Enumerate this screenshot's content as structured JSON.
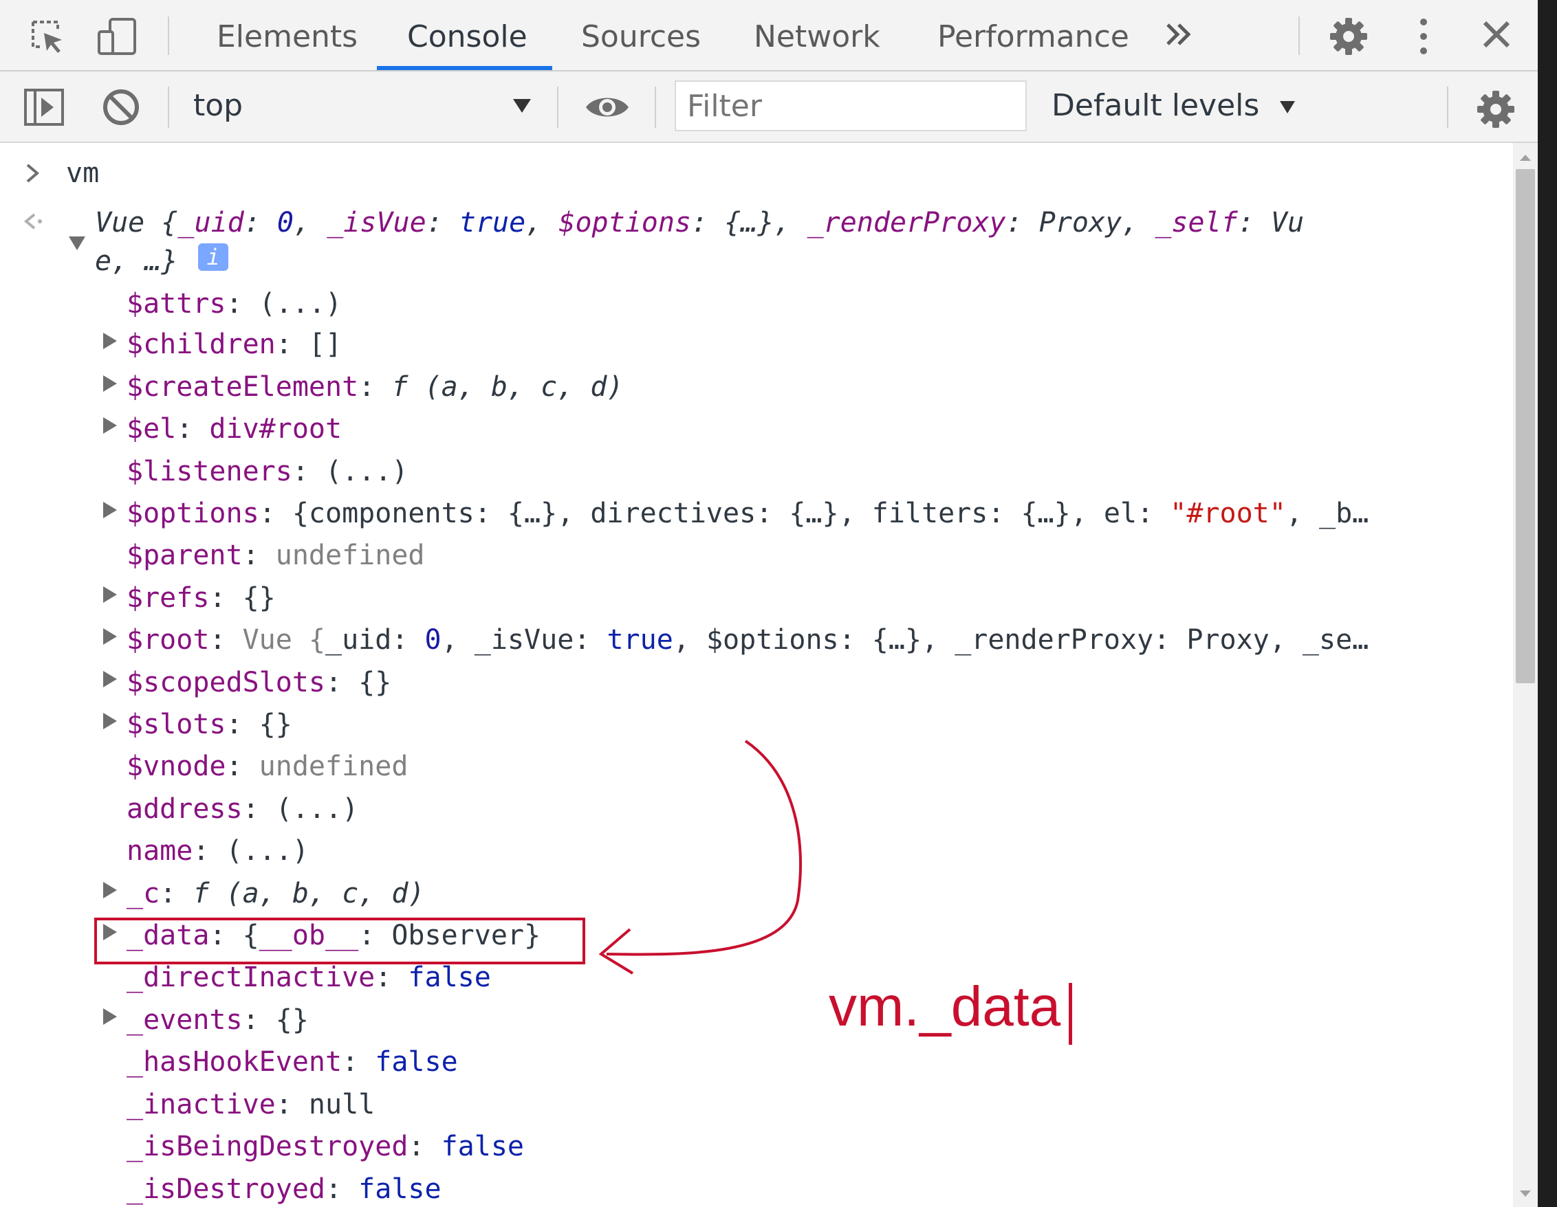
{
  "tabs": [
    {
      "label": "Elements"
    },
    {
      "label": "Console",
      "active": true
    },
    {
      "label": "Sources"
    },
    {
      "label": "Network"
    },
    {
      "label": "Performance"
    }
  ],
  "tabbar_icons": [
    "inspect-element-icon",
    "device-toolbar-icon",
    "more-tabs-icon",
    "settings-gear-icon",
    "kebab-menu-icon",
    "close-icon"
  ],
  "toolbar": {
    "context": "top",
    "filter_placeholder": "Filter",
    "levels": "Default levels"
  },
  "console": {
    "input": "vm",
    "summary": {
      "line1": [
        "Vue {",
        "_uid",
        ": ",
        "0",
        ", ",
        "_isVue",
        ": ",
        "true",
        ", ",
        "$options",
        ": {…}, ",
        "_renderProxy",
        ": Proxy, ",
        "_self",
        ": Vu"
      ],
      "line2": "e, …}"
    },
    "props": [
      {
        "key": "$attrs",
        "sep": ": ",
        "value": "(...)",
        "expandable": false
      },
      {
        "key": "$children",
        "sep": ": ",
        "value": "[]",
        "expandable": true
      },
      {
        "key": "$createElement",
        "sep": ": ",
        "value": "f (a, b, c, d)",
        "expandable": true
      },
      {
        "key": "$el",
        "sep": ": ",
        "value": "div#root",
        "expandable": true
      },
      {
        "key": "$listeners",
        "sep": ": ",
        "value": "(...)",
        "expandable": false
      },
      {
        "key": "$options",
        "sep": ": ",
        "value_parts": [
          "{",
          "components",
          ": {…}, ",
          "directives",
          ": {…}, ",
          "filters",
          ": {…}, ",
          "el",
          ": ",
          "\"#root\"",
          ", ",
          "_b…"
        ],
        "expandable": true
      },
      {
        "key": "$parent",
        "sep": ": ",
        "value": "undefined",
        "expandable": false
      },
      {
        "key": "$refs",
        "sep": ": ",
        "value": "{}",
        "expandable": true
      },
      {
        "key": "$root",
        "sep": ": ",
        "value_parts": [
          "Vue {",
          "_uid",
          ": ",
          "0",
          ", ",
          "_isVue",
          ": ",
          "true",
          ", ",
          "$options",
          ": {…}, ",
          "_renderProxy",
          ": Proxy, ",
          "_se…"
        ],
        "expandable": true
      },
      {
        "key": "$scopedSlots",
        "sep": ": ",
        "value": "{}",
        "expandable": true
      },
      {
        "key": "$slots",
        "sep": ": ",
        "value": "{}",
        "expandable": true
      },
      {
        "key": "$vnode",
        "sep": ": ",
        "value": "undefined",
        "expandable": false
      },
      {
        "key": "address",
        "sep": ": ",
        "value": "(...)",
        "expandable": false
      },
      {
        "key": "name",
        "sep": ": ",
        "value": "(...)",
        "expandable": false
      },
      {
        "key": "_c",
        "sep": ": ",
        "value": "f (a, b, c, d)",
        "expandable": true
      },
      {
        "key": "_data",
        "sep": ": ",
        "value_parts": [
          "{",
          "__ob__",
          ": Observer}"
        ],
        "expandable": true
      },
      {
        "key": "_directInactive",
        "sep": ": ",
        "value": "false",
        "expandable": false
      },
      {
        "key": "_events",
        "sep": ": ",
        "value": "{}",
        "expandable": true
      },
      {
        "key": "_hasHookEvent",
        "sep": ": ",
        "value": "false",
        "expandable": false
      },
      {
        "key": "_inactive",
        "sep": ": ",
        "value": "null",
        "expandable": false
      },
      {
        "key": "_isBeingDestroyed",
        "sep": ": ",
        "value": "false",
        "expandable": false
      },
      {
        "key": "_isDestroyed",
        "sep": ": ",
        "value": "false",
        "expandable": false
      }
    ]
  },
  "annotation": {
    "text": "vm._data",
    "color": "#c8102e"
  },
  "colors": {
    "accent": "#1a73e8",
    "property_key": "#881280",
    "string": "#c41a16",
    "number": "#1a1aa6",
    "keyword": "#0d22aa"
  }
}
